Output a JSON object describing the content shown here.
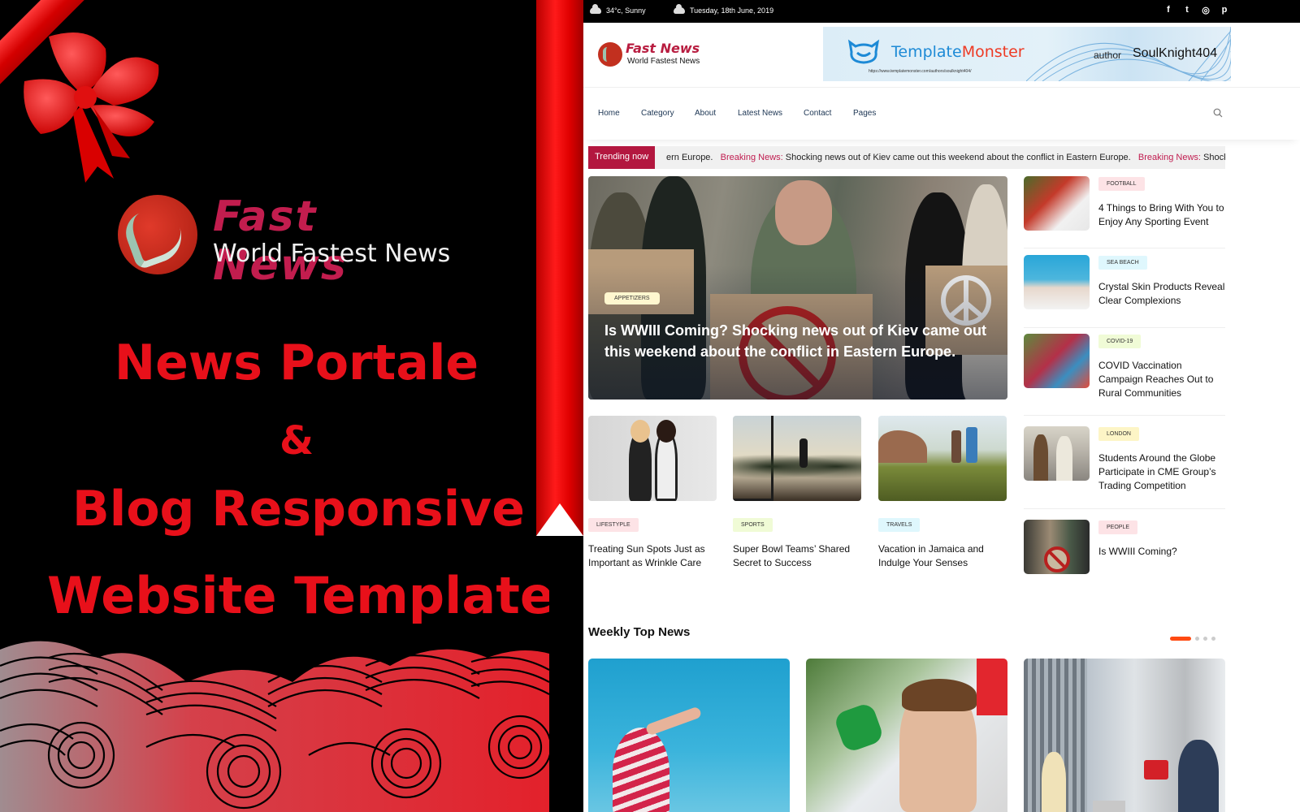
{
  "promo": {
    "brand": "Fast News",
    "tagline": "World Fastest News",
    "headline_lines": [
      "News Portale",
      "&",
      "Blog Responsive",
      "Website Template"
    ]
  },
  "topbar": {
    "weather": "34°c, Sunny",
    "date": "Tuesday, 18th June, 2019",
    "social": [
      {
        "icon": "facebook-icon",
        "glyph": "f"
      },
      {
        "icon": "twitter-icon",
        "glyph": "t"
      },
      {
        "icon": "instagram-icon",
        "glyph": "◎"
      },
      {
        "icon": "pinterest-icon",
        "glyph": "p"
      }
    ]
  },
  "header": {
    "logo_brand": "Fast News",
    "logo_tagline": "World Fastest News",
    "banner": {
      "name_part1": "Template",
      "name_part2": "Monster",
      "url": "https://www.templatemonster.com/authors/soulknight404/",
      "author_label": "author",
      "author_name": "SoulKnight404"
    }
  },
  "nav": {
    "items": [
      "Home",
      "Category",
      "About",
      "Latest News",
      "Contact",
      "Pages"
    ],
    "search_icon": "search-icon"
  },
  "ticker": {
    "label": "Trending now",
    "lead_fragment": "ern Europe.",
    "items": [
      {
        "prefix": "Breaking News:",
        "text": " Shocking news out of Kiev came out this weekend about the conflict in Eastern Europe."
      },
      {
        "prefix": "Breaking News:",
        "text": " Shocking news out of Kiev came out this weekend about the conflict in Eastern Europe."
      }
    ]
  },
  "hero": {
    "category": "APPETIZERS",
    "title": "Is WWIII Coming? Shocking news out of Kiev came out this weekend about the conflict in Eastern Europe."
  },
  "cards": [
    {
      "category": "LIFESTYPLE",
      "title": "Treating Sun Spots Just as Important as Wrinkle Care",
      "tag_color": "#fde3e6"
    },
    {
      "category": "SPORTS",
      "title": "Super Bowl Teams’ Shared Secret to Success",
      "tag_color": "#f0fbd6"
    },
    {
      "category": "TRAVELS",
      "title": "Vacation in Jamaica and Indulge Your Senses",
      "tag_color": "#dff7fd"
    }
  ],
  "sidebar": [
    {
      "category": "FOOTBALL",
      "title": "4 Things to Bring With You to Enjoy Any Sporting Event",
      "tag_color": "#fde3e6"
    },
    {
      "category": "SEA BEACH",
      "title": "Crystal Skin Products Reveal Clear Complexions",
      "tag_color": "#dff7fd"
    },
    {
      "category": "COVID-19",
      "title": "COVID Vaccination Campaign Reaches Out to Rural Communities",
      "tag_color": "#f0fbd6"
    },
    {
      "category": "LONDON",
      "title": "Students Around the Globe Participate in CME Group’s Trading Competition",
      "tag_color": "#fdf5c6"
    },
    {
      "category": "PEOPLE",
      "title": "Is WWIII Coming?",
      "tag_color": "#fde3e6"
    }
  ],
  "weekly": {
    "title": "Weekly Top News",
    "active_slide": 1,
    "slide_count": 4
  },
  "colors": {
    "accent_red": "#e8101a",
    "brand_crimson": "#b3173f",
    "pager_active": "#ff4a12"
  }
}
